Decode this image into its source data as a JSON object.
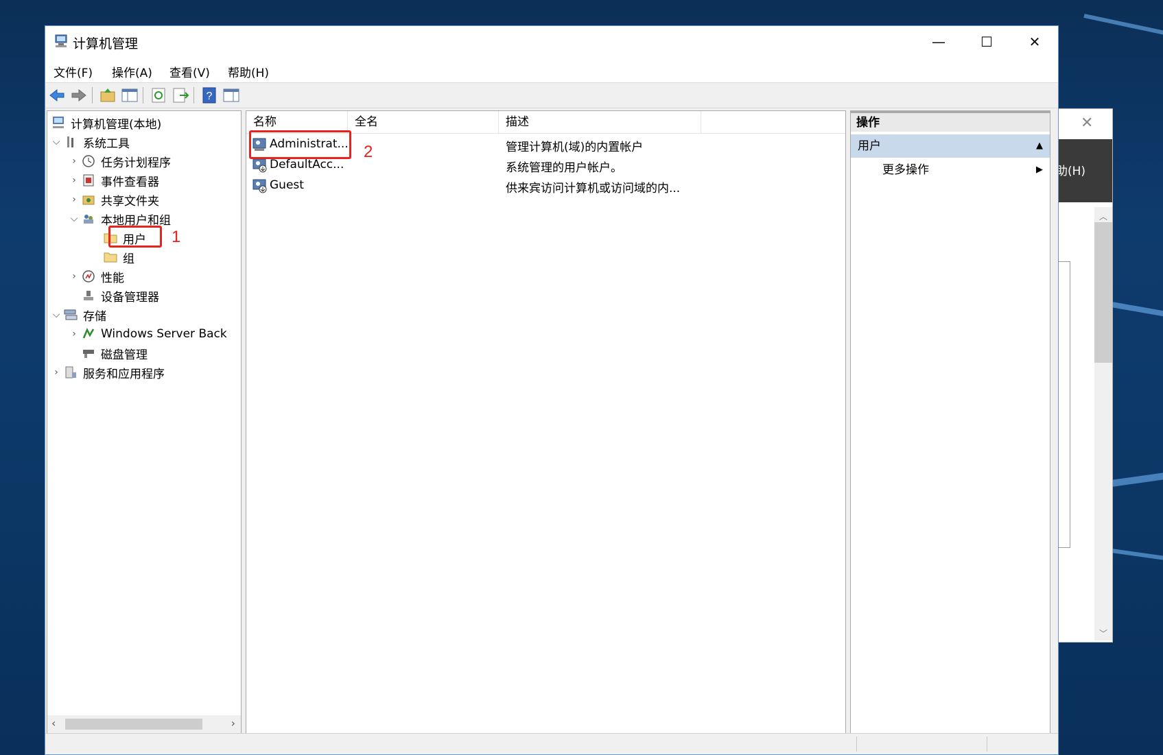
{
  "window": {
    "title": "计算机管理"
  },
  "menu": [
    "文件(F)",
    "操作(A)",
    "查看(V)",
    "帮助(H)"
  ],
  "tree": {
    "root": "计算机管理(本地)",
    "items": [
      {
        "label": "系统工具"
      },
      {
        "label": "任务计划程序"
      },
      {
        "label": "事件查看器"
      },
      {
        "label": "共享文件夹"
      },
      {
        "label": "本地用户和组"
      },
      {
        "label": "用户"
      },
      {
        "label": "组"
      },
      {
        "label": "性能"
      },
      {
        "label": "设备管理器"
      },
      {
        "label": "存储"
      },
      {
        "label": "Windows Server Back"
      },
      {
        "label": "磁盘管理"
      },
      {
        "label": "服务和应用程序"
      }
    ]
  },
  "list": {
    "columns": [
      "名称",
      "全名",
      "描述"
    ],
    "rows": [
      {
        "name": "Administrat...",
        "fullname": "",
        "desc": "管理计算机(域)的内置帐户"
      },
      {
        "name": "DefaultAcc...",
        "fullname": "",
        "desc": "系统管理的用户帐户。"
      },
      {
        "name": "Guest",
        "fullname": "",
        "desc": "供来宾访问计算机或访问域的内..."
      }
    ]
  },
  "actions": {
    "title": "操作",
    "group": "用户",
    "more": "更多操作"
  },
  "annotations": {
    "one": "1",
    "two": "2"
  },
  "background_window": {
    "menu_fragment": "助(H)"
  },
  "colors": {
    "annotation": "#e8231e",
    "selection": "#c9d9ec"
  }
}
